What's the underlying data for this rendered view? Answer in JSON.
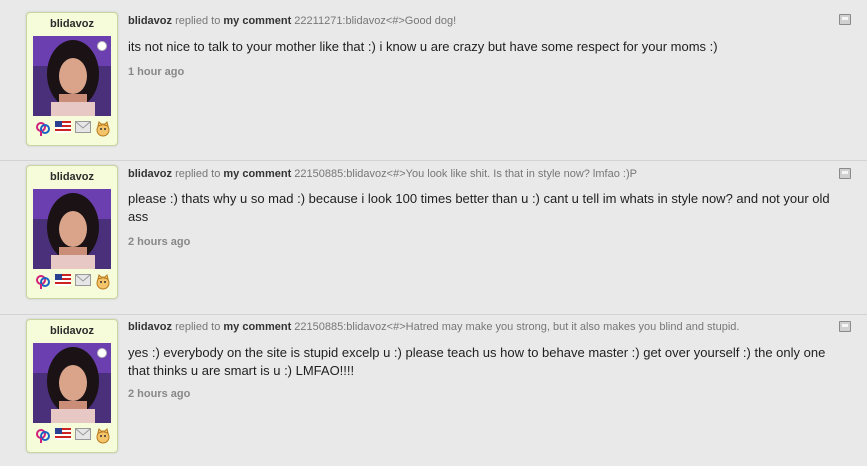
{
  "comments": [
    {
      "username": "blidavoz",
      "replied_text": " replied to ",
      "target": "my comment",
      "ref": " 22211271:blidavoz<#>Good dog!",
      "body": "its not nice to talk to your mother like that :) i know u are crazy but have some respect for your moms :)",
      "time": "1 hour ago"
    },
    {
      "username": "blidavoz",
      "replied_text": " replied to ",
      "target": "my comment",
      "ref": " 22150885:blidavoz<#>You look like shit. Is that in style now? lmfao :)P",
      "body": "please :) thats why u so mad :) because i look 100 times better than u :) cant u tell im whats in style now? and not your old ass",
      "time": "2 hours ago"
    },
    {
      "username": "blidavoz",
      "replied_text": " replied to ",
      "target": "my comment",
      "ref": " 22150885:blidavoz<#>Hatred may make you strong, but it also makes you blind and stupid.",
      "body": "yes :) everybody on the site is stupid excelp u :) please teach us how to behave master :) get over yourself :) the only one that thinks u are smart is u :) LMFAO!!!!",
      "time": "2 hours ago"
    }
  ],
  "icons": [
    "gender-icon",
    "us-flag-icon",
    "message-icon",
    "cat-icon"
  ],
  "colors": {
    "card_bg": "#f6fbd9",
    "page_bg": "#e9e9e9"
  }
}
